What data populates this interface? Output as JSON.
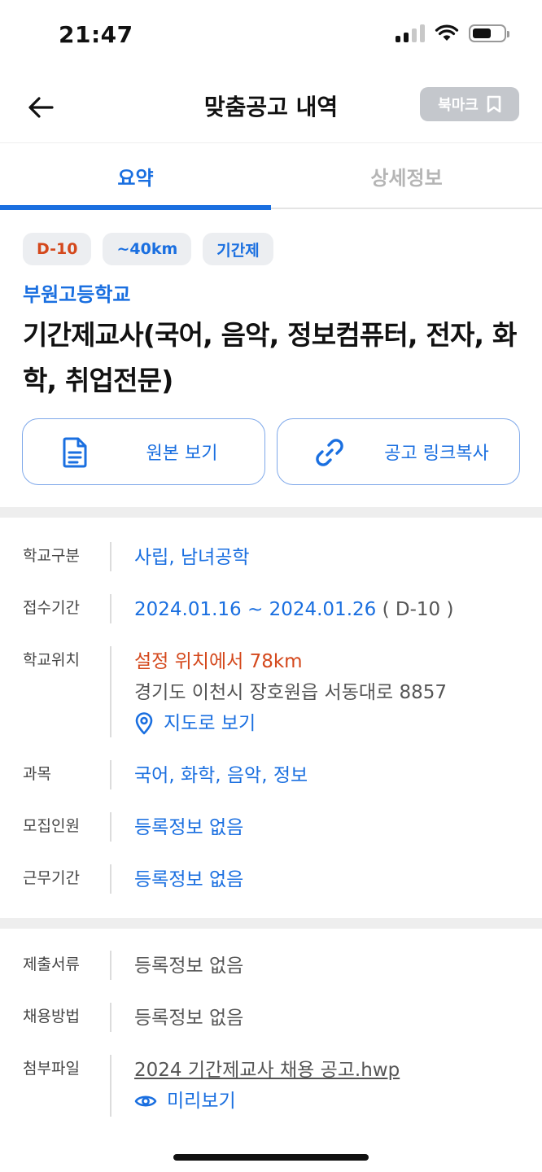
{
  "status": {
    "time": "21:47"
  },
  "header": {
    "title": "맞춤공고 내역",
    "bookmark_label": "북마크"
  },
  "tabs": [
    {
      "label": "요약",
      "active": true
    },
    {
      "label": "상세정보",
      "active": false
    }
  ],
  "summary": {
    "chips": [
      "D-10",
      "~40km",
      "기간제"
    ],
    "school": "부원고등학교",
    "title": "기간제교사(국어, 음악, 정보컴퓨터, 전자, 화학, 취업전문)"
  },
  "actions": {
    "original_label": "원본 보기",
    "copy_link_label": "공고 링크복사"
  },
  "info": {
    "school_type": {
      "label": "학교구분",
      "value": "사립, 남녀공학"
    },
    "period": {
      "label": "접수기간",
      "value": "2024.01.16 ~ 2024.01.26",
      "dday": "( D-10 )"
    },
    "location": {
      "label": "학교위치",
      "distance": "설정 위치에서 78km",
      "address": "경기도 이천시 장호원읍 서동대로 8857",
      "map_label": "지도로 보기"
    },
    "subject": {
      "label": "과목",
      "value": "국어, 화학, 음악, 정보"
    },
    "headcount": {
      "label": "모집인원",
      "value": "등록정보 없음"
    },
    "work_period": {
      "label": "근무기간",
      "value": "등록정보 없음"
    }
  },
  "extra": {
    "documents": {
      "label": "제출서류",
      "value": "등록정보 없음"
    },
    "method": {
      "label": "채용방법",
      "value": "등록정보 없음"
    },
    "attachment": {
      "label": "첨부파일",
      "file": "2024 기간제교사 채용 공고.hwp",
      "preview_label": "미리보기"
    }
  },
  "colors": {
    "accent": "#1a6fe0",
    "alert": "#d4481c",
    "bookmark_bg": "#c4c7cc"
  }
}
